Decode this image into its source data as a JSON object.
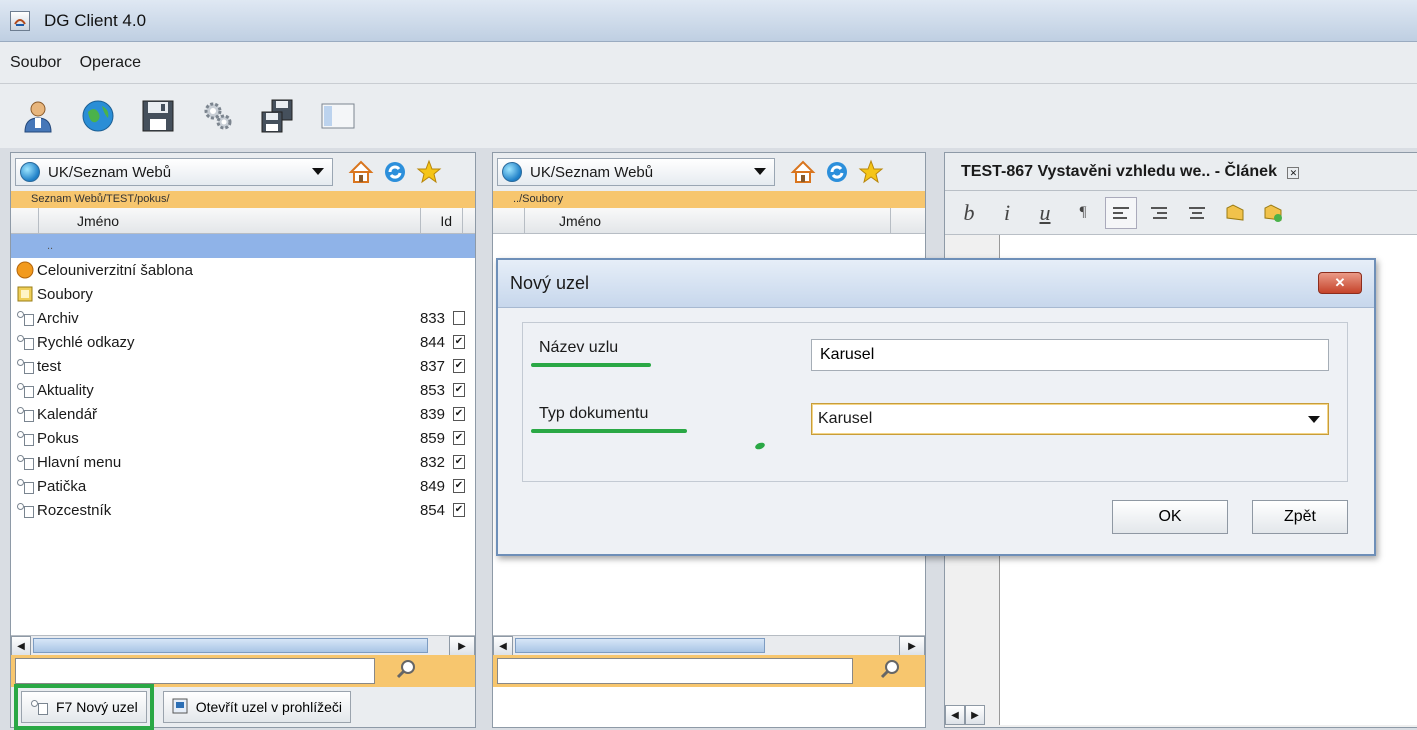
{
  "window": {
    "title": "DG Client 4.0"
  },
  "menu": {
    "items": [
      "Soubor",
      "Operace"
    ]
  },
  "toolbar": {
    "buttons": [
      "user-icon",
      "globe-icon",
      "save-icon",
      "settings-gears-icon",
      "publish-icon",
      "panel-layout-icon"
    ]
  },
  "left_panel": {
    "site_selector": "UK/Seznam Webů",
    "path": "Seznam Webů/TEST/pokus/",
    "columns": {
      "name": "Jméno",
      "id": "Id"
    },
    "parent_row": "..",
    "rows": [
      {
        "name": "Celouniverzitní šablona",
        "id": "",
        "icon": "template-icon"
      },
      {
        "name": "Soubory",
        "id": "",
        "icon": "files-folder-icon"
      },
      {
        "name": "Archiv",
        "id": "833",
        "icon": "node-icon"
      },
      {
        "name": "Rychlé odkazy",
        "id": "844",
        "icon": "node-icon"
      },
      {
        "name": "test",
        "id": "837",
        "icon": "node-icon"
      },
      {
        "name": "Aktuality",
        "id": "853",
        "icon": "node-icon"
      },
      {
        "name": "Kalendář",
        "id": "839",
        "icon": "node-icon"
      },
      {
        "name": "Pokus",
        "id": "859",
        "icon": "node-icon"
      },
      {
        "name": "Hlavní menu",
        "id": "832",
        "icon": "node-icon"
      },
      {
        "name": "Patička",
        "id": "849",
        "icon": "node-icon"
      },
      {
        "name": "Rozcestník",
        "id": "854",
        "icon": "node-icon"
      }
    ],
    "search_value": "",
    "buttons": {
      "new_node": "F7 Nový uzel",
      "open_in_browser": "Otevřít uzel v prohlížeči"
    }
  },
  "middle_panel": {
    "site_selector": "UK/Seznam Webů",
    "path": "../Soubory",
    "columns": {
      "name": "Jméno"
    },
    "search_value": ""
  },
  "right_panel": {
    "tab_title": "TEST-867 Vystavěni vzhledu we.. - Článek",
    "editor_buttons": [
      "b",
      "i",
      "u",
      "¶"
    ]
  },
  "dialog": {
    "title": "Nový uzel",
    "close_label": "✕",
    "name_label": "Název uzlu",
    "name_value": "Karusel",
    "type_label": "Typ dokumentu",
    "type_value": "Karusel",
    "ok_label": "OK",
    "back_label": "Zpět"
  },
  "colors": {
    "highlight": "#2aa845",
    "path_bar": "#f7c66e",
    "selection": "#8fb3e8"
  }
}
